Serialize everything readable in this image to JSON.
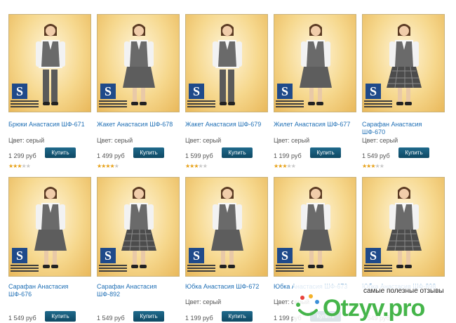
{
  "row1": [
    {
      "title": "Брюки Анастасия ШФ-671",
      "color": "Цвет: серый",
      "price": "1 299 руб",
      "buy": "Купить",
      "rating": 3
    },
    {
      "title": "Жакет Анастасия ШФ-678",
      "color": "Цвет: серый",
      "price": "1 499 руб",
      "buy": "Купить",
      "rating": 4
    },
    {
      "title": "Жакет Анастасия ШФ-679",
      "color": "Цвет: серый",
      "price": "1 599 руб",
      "buy": "Купить",
      "rating": 3
    },
    {
      "title": "Жилет Анастасия ШФ-677",
      "color": "Цвет: серый",
      "price": "1 199 руб",
      "buy": "Купить",
      "rating": 3
    },
    {
      "title": "Сарафан Анастасия ШФ-670",
      "color": "Цвет: серый",
      "price": "1 549 руб",
      "buy": "Купить",
      "rating": 3
    }
  ],
  "row2": [
    {
      "title": "Сарафан Анастасия ШФ-676",
      "color": "",
      "price": "1 549 руб",
      "buy": "Купить"
    },
    {
      "title": "Сарафан Анастасия ШФ-892",
      "color": "",
      "price": "1 549 руб",
      "buy": "Купить"
    },
    {
      "title": "Юбка Анастасия ШФ-672",
      "color": "Цвет: серый",
      "price": "1 199 руб",
      "buy": "Купить"
    },
    {
      "title": "Юбка Анастасия ШФ-673",
      "color": "Цвет: серый",
      "price": "1 199 руб",
      "buy": "Купить"
    },
    {
      "title": "Юбка Анастасия ШФ-898",
      "color": "",
      "price": "1 549 руб",
      "buy": ""
    }
  ],
  "watermark": {
    "subtitle": "самые полезные отзывы",
    "logo": "Otzyv.pro"
  },
  "colors": {
    "link": "#1f6fb5",
    "button": "#0e4863",
    "star": "#e7a21a",
    "brand": "#45b54a"
  }
}
